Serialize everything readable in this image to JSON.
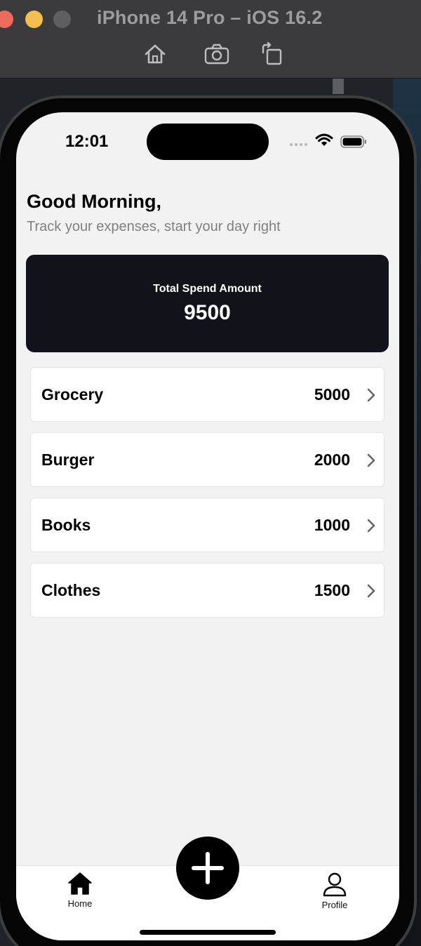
{
  "window": {
    "title": "iPhone 14 Pro – iOS 16.2",
    "toolbar": {
      "home_icon": "home-icon",
      "screenshot_icon": "camera-icon",
      "rotate_icon": "rotate-icon"
    }
  },
  "status_bar": {
    "time": "12:01"
  },
  "header": {
    "greeting": "Good Morning,",
    "subtitle": "Track your expenses, start your day right"
  },
  "summary": {
    "label": "Total Spend Amount",
    "value": "9500"
  },
  "expenses": [
    {
      "name": "Grocery",
      "amount": "5000"
    },
    {
      "name": "Burger",
      "amount": "2000"
    },
    {
      "name": "Books",
      "amount": "1000"
    },
    {
      "name": "Clothes",
      "amount": "1500"
    }
  ],
  "tab_bar": {
    "home_label": "Home",
    "profile_label": "Profile",
    "add_icon": "plus-icon"
  },
  "colors": {
    "card_background": "#11121a",
    "screen_background": "#f2f2f2",
    "accent": "#000000"
  }
}
